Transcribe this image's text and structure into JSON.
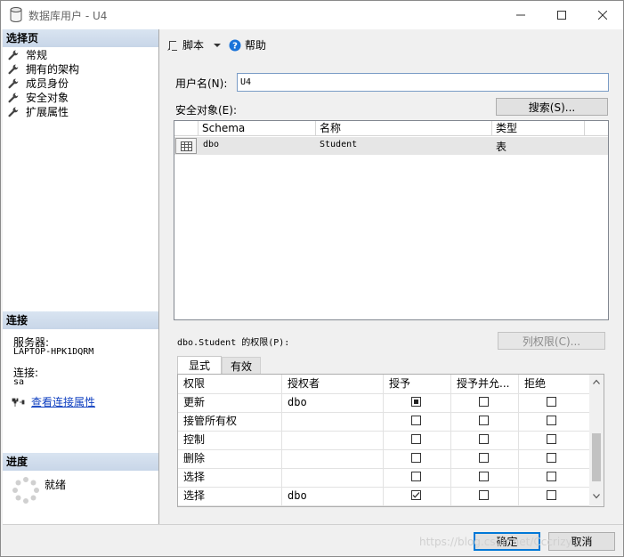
{
  "window": {
    "title": "数据库用户 - U4"
  },
  "left": {
    "select_page_header": "选择页",
    "pages": [
      "常规",
      "拥有的架构",
      "成员身份",
      "安全对象",
      "扩展属性"
    ],
    "connection_header": "连接",
    "server_label": "服务器:",
    "server_value": "LAPTOP-HPK1DQRM",
    "connection_label": "连接:",
    "connection_value": "sa",
    "view_connection_link": "查看连接属性",
    "progress_header": "进度",
    "progress_status": "就绪"
  },
  "toolbar": {
    "script_label": "脚本",
    "help_label": "帮助"
  },
  "form": {
    "username_label": "用户名(N):",
    "username_value": "U4",
    "securables_label": "安全对象(E):",
    "search_button": "搜索(S)..."
  },
  "securables": {
    "columns": [
      "Schema",
      "名称",
      "类型"
    ],
    "rows": [
      {
        "schema": "dbo",
        "name": "Student",
        "type": "表"
      }
    ]
  },
  "permissions": {
    "label": "dbo.Student 的权限(P):",
    "column_permissions_button": "列权限(C)...",
    "tabs": [
      "显式",
      "有效"
    ],
    "columns": [
      "权限",
      "授权者",
      "授予",
      "授予并允...",
      "拒绝"
    ],
    "rows": [
      {
        "permission": "更新",
        "grantor": "dbo",
        "grant": "indeterminate",
        "with_grant": false,
        "deny": false
      },
      {
        "permission": "接管所有权",
        "grantor": "",
        "grant": false,
        "with_grant": false,
        "deny": false
      },
      {
        "permission": "控制",
        "grantor": "",
        "grant": false,
        "with_grant": false,
        "deny": false
      },
      {
        "permission": "删除",
        "grantor": "",
        "grant": false,
        "with_grant": false,
        "deny": false
      },
      {
        "permission": "选择",
        "grantor": "",
        "grant": false,
        "with_grant": false,
        "deny": false
      },
      {
        "permission": "选择",
        "grantor": "dbo",
        "grant": true,
        "with_grant": false,
        "deny": false
      }
    ]
  },
  "footer": {
    "ok_button": "确定",
    "cancel_button": "取消"
  },
  "watermark": "https://blog.csdn.net/Cccrizy..."
}
